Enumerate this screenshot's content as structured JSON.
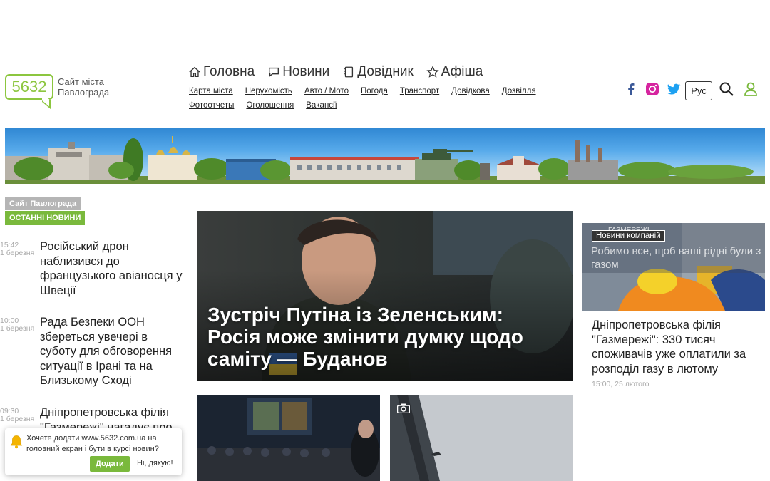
{
  "header": {
    "logo_number": "5632",
    "logo_text": "Сайт міста Павлограда",
    "main_nav": [
      {
        "label": "Головна",
        "icon": "home-icon"
      },
      {
        "label": "Новини",
        "icon": "chat-icon"
      },
      {
        "label": "Довідник",
        "icon": "book-icon"
      },
      {
        "label": "Афіша",
        "icon": "star-icon"
      }
    ],
    "sub_nav": [
      "Карта міста",
      "Нерухомість",
      "Авто / Мото",
      "Погода",
      "Транспорт",
      "Довідкова",
      "Дозвілля",
      "Фотоотчеты",
      "Оголошення",
      "Вакансії"
    ],
    "lang": "Рус",
    "colors": {
      "facebook": "#3b5998",
      "instagram": "#d6249f",
      "twitter": "#1da1f2",
      "accent": "#8cc63f"
    }
  },
  "left": {
    "site_tag": "Сайт Павлограда",
    "latest_tag": "ОСТАННІ НОВИНИ",
    "news": [
      {
        "time": "15:42",
        "date": "1 березня",
        "title": "Російський дрон наблизився до французького авіаносця у Швеції"
      },
      {
        "time": "10:00",
        "date": "1 березня",
        "title": "Рада Безпеки ООН збереться увечері в суботу для обговорення ситуації в Ірані та на Близькому Сході"
      },
      {
        "time": "09:30",
        "date": "1 березня",
        "title": "Дніпропетровська філія \"Газмережі\" нагадує про"
      }
    ]
  },
  "feature": {
    "title": "Зустріч Путіна із Зеленським: Росія може змінити думку щодо саміту — Буданов"
  },
  "right": {
    "tag": "Новини компаній",
    "brand": "ГАЗМЕРЕЖІ",
    "overlay": "Робимо все, щоб ваші рідні були з газом",
    "title": "Дніпропетровська філія \"Газмережі\": 330 тисяч споживачів уже оплатили за розподіл газу в лютому",
    "date": "15:00, 25 лютого"
  },
  "push": {
    "text": "Хочете додати www.5632.com.ua на головний екран і бути в курсі новин?",
    "ok": "Додати",
    "no": "Ні, дякую!"
  }
}
